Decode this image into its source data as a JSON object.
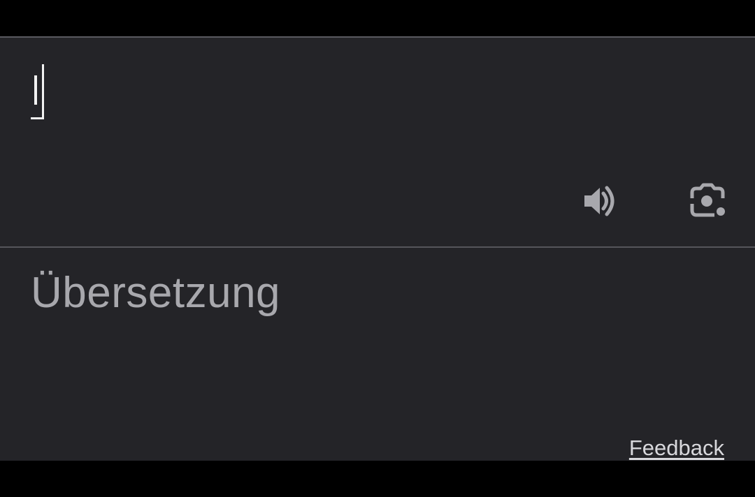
{
  "source": {
    "value": ""
  },
  "toolbar": {
    "speak_icon": "speaker-icon",
    "lens_icon": "camera-lens-icon"
  },
  "translation": {
    "placeholder": "Übersetzung"
  },
  "footer": {
    "feedback_label": "Feedback"
  },
  "colors": {
    "panel_bg": "#242428",
    "icon": "#a8a8ad",
    "placeholder_text": "#a8a8ad",
    "link_text": "#d8d8dc"
  }
}
